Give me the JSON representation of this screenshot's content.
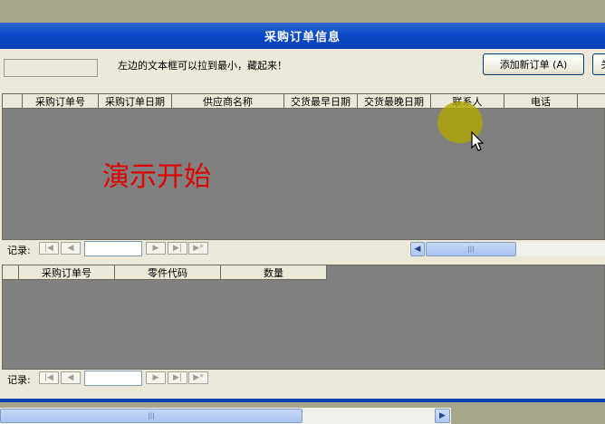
{
  "window": {
    "title": "采购订单信息"
  },
  "toolbar": {
    "hint": "左边的文本框可以拉到最小，藏起来！",
    "add_button": "添加新订单 (A)",
    "extra_button": "关"
  },
  "main_grid": {
    "columns": [
      "采购订单号",
      "采购订单日期",
      "供应商名称",
      "交货最早日期",
      "交货最晚日期",
      "联系人",
      "电话"
    ],
    "overlay_text": "演示开始"
  },
  "detail_grid": {
    "columns": [
      "采购订单号",
      "零件代码",
      "数量"
    ]
  },
  "navigator": {
    "label": "记录:",
    "icons": [
      "first-record-icon",
      "prev-record-icon",
      "next-record-icon",
      "last-record-icon",
      "new-record-icon"
    ]
  },
  "colors": {
    "titlebar": "#0a49c8",
    "form_bg": "#ece9d8",
    "grid_bg": "#808080",
    "demo_text": "#e00000",
    "cursor_highlight": "#b0a600"
  }
}
